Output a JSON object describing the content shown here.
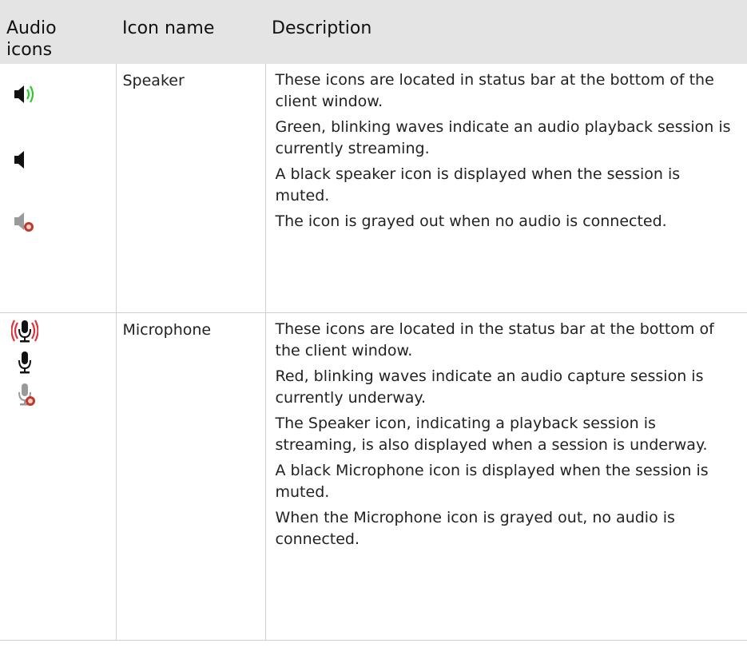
{
  "table": {
    "headers": [
      "Audio icons",
      "Icon name",
      "Description"
    ],
    "header_lines": {
      "audio_line1": "Audio",
      "audio_line2": "icons"
    },
    "rows": [
      {
        "icons": [
          "speaker-streaming-icon",
          "speaker-muted-icon",
          "speaker-disconnected-icon"
        ],
        "name": "Speaker",
        "paragraphs": [
          "These icons are located in status bar at the bottom of the client window.",
          "Green, blinking waves indicate an audio playback session is currently streaming.",
          "A black speaker icon is displayed when the session is muted.",
          "The icon is grayed out when no audio is connected."
        ]
      },
      {
        "icons": [
          "microphone-capturing-icon",
          "microphone-muted-icon",
          "microphone-disconnected-icon"
        ],
        "name": "Microphone",
        "paragraphs": [
          "These icons are located in the status bar at the bottom of the client window.",
          "Red, blinking waves indicate an audio capture session is currently underway.",
          "The Speaker icon, indicating a playback session is streaming, is also displayed when a session is underway.",
          "A black Microphone icon is displayed when the session is muted.",
          "When the Microphone icon is grayed out, no audio is connected."
        ]
      }
    ]
  },
  "colors": {
    "header_bg": "#e4e4e4",
    "wave_green": "#2ec92e",
    "wave_red": "#e0303a",
    "grid": "#cfcfcf"
  }
}
